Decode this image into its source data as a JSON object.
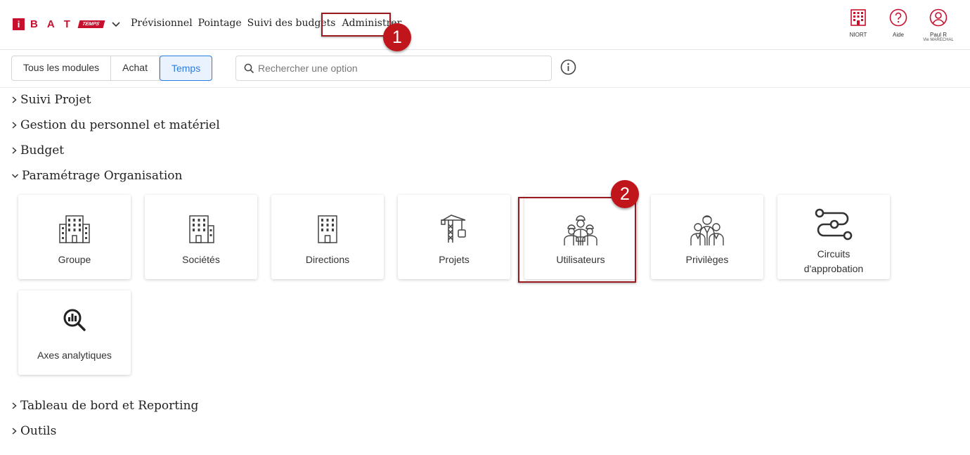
{
  "header": {
    "logo_letters": [
      "B",
      "A",
      "T"
    ],
    "logo_badge": "TEMPS",
    "nav": [
      "Prévisionnel",
      "Pointage",
      "Suivi des budgets",
      "Administrer"
    ],
    "site_label": "NIORT",
    "help_label": "Aide",
    "user_name": "Paul R",
    "user_sub": "Vie MARECHAL"
  },
  "annotations": {
    "step1": "1",
    "step2": "2"
  },
  "toolbar": {
    "filters": [
      "Tous les modules",
      "Achat",
      "Temps"
    ],
    "active_filter": "Temps",
    "search_placeholder": "Rechercher une option"
  },
  "sections": [
    {
      "label": "Suivi Projet",
      "expanded": false
    },
    {
      "label": "Gestion du personnel et matériel",
      "expanded": false
    },
    {
      "label": "Budget",
      "expanded": false
    },
    {
      "label": "Paramétrage Organisation",
      "expanded": true
    },
    {
      "label": "Tableau de bord et Reporting",
      "expanded": false
    },
    {
      "label": "Outils",
      "expanded": false
    }
  ],
  "tiles": [
    {
      "label": "Groupe",
      "icon": "building-group-icon"
    },
    {
      "label": "Sociétés",
      "icon": "building-company-icon"
    },
    {
      "label": "Directions",
      "icon": "building-icon"
    },
    {
      "label": "Projets",
      "icon": "crane-icon"
    },
    {
      "label": "Utilisateurs",
      "icon": "workers-icon"
    },
    {
      "label": "Privilèges",
      "icon": "people-icon"
    },
    {
      "label": "Circuits d'approbation",
      "line1": "Circuits",
      "line2": "d'approbation",
      "icon": "workflow-icon"
    },
    {
      "label": "Axes analytiques",
      "icon": "analytics-search-icon"
    }
  ],
  "colors": {
    "brand": "#c8102e",
    "accent": "#2a7de1",
    "annotation": "#c0161b"
  }
}
